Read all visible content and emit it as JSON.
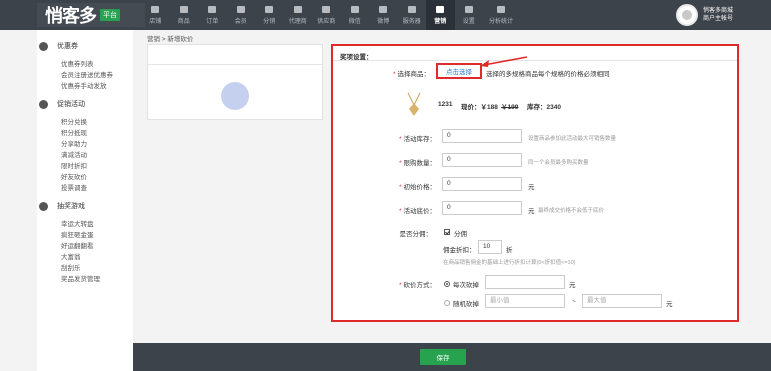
{
  "app": {
    "logo_text": "悄客多",
    "logo_badge": "平台"
  },
  "topnav": [
    {
      "label": "店铺",
      "icon": "store-icon"
    },
    {
      "label": "商品",
      "icon": "bag-icon"
    },
    {
      "label": "订单",
      "icon": "order-icon"
    },
    {
      "label": "会员",
      "icon": "member-icon"
    },
    {
      "label": "分销",
      "icon": "distribution-icon"
    },
    {
      "label": "代理商",
      "icon": "agent-icon"
    },
    {
      "label": "供应商",
      "icon": "supplier-icon"
    },
    {
      "label": "微信",
      "icon": "wechat-icon"
    },
    {
      "label": "微博",
      "icon": "weibo-icon"
    },
    {
      "label": "服务器",
      "icon": "server-icon"
    },
    {
      "label": "营销",
      "icon": "marketing-icon"
    },
    {
      "label": "设置",
      "icon": "settings-icon"
    },
    {
      "label": "分析统计",
      "icon": "analytics-icon"
    }
  ],
  "user": {
    "line1": "悄客多商城",
    "line2": "商户主帐号"
  },
  "sidebar": {
    "groups": [
      {
        "title": "优惠券",
        "icon": "coupon-icon",
        "items": [
          "优惠券列表",
          "会员注册送优惠券",
          "优惠券手动发放"
        ]
      },
      {
        "title": "促销活动",
        "icon": "promotion-icon",
        "items": [
          "积分兑换",
          "积分抵现",
          "分享助力",
          "满减活动",
          "限时折扣",
          "好友砍价",
          "投票调查"
        ]
      },
      {
        "title": "抽奖游戏",
        "icon": "lottery-icon",
        "items": [
          "幸运大转盘",
          "疯狂砸金蛋",
          "好运翻翻看",
          "大富翁",
          "刮刮乐",
          "奖品发货管理"
        ]
      }
    ]
  },
  "breadcrumb": "营销 > 新增砍价",
  "form": {
    "section_title": "奖项设置：",
    "choose_product": {
      "label": "选择商品：",
      "button": "点击选择",
      "hint": "选择的多规格商品每个规格的价格必须相同"
    },
    "product": {
      "id": "1231",
      "price_text": "现价：￥188",
      "old_price": "￥199",
      "stock_text": "库存：2340"
    },
    "stock": {
      "label": "活动库存：",
      "value": "0",
      "hint": "设置商品参加此活动最大可销售数量"
    },
    "limit": {
      "label": "限购数量：",
      "value": "0",
      "hint": "同一个会员最多购买数量"
    },
    "init_price": {
      "label": "初始价格：",
      "value": "0",
      "unit": "元"
    },
    "floor_price": {
      "label": "活动底价：",
      "value": "0",
      "unit": "元",
      "hint": "最终成交价格不会低于底价"
    },
    "commission": {
      "label": "是否分佣：",
      "checkbox_label": "分佣",
      "rate_label": "佣金折扣：",
      "rate_value": "10",
      "rate_unit": "折",
      "hint": "在商品销售佣金的基础上进行折扣计算(0<折扣值<=10)"
    },
    "bargain": {
      "label": "砍价方式：",
      "option1": "每次砍掉",
      "unit1": "元",
      "option2": "随机砍掉",
      "min_placeholder": "最小值",
      "separator": "~",
      "max_placeholder": "最大值",
      "unit2": "元"
    }
  },
  "footer": {
    "save_label": "保存"
  }
}
